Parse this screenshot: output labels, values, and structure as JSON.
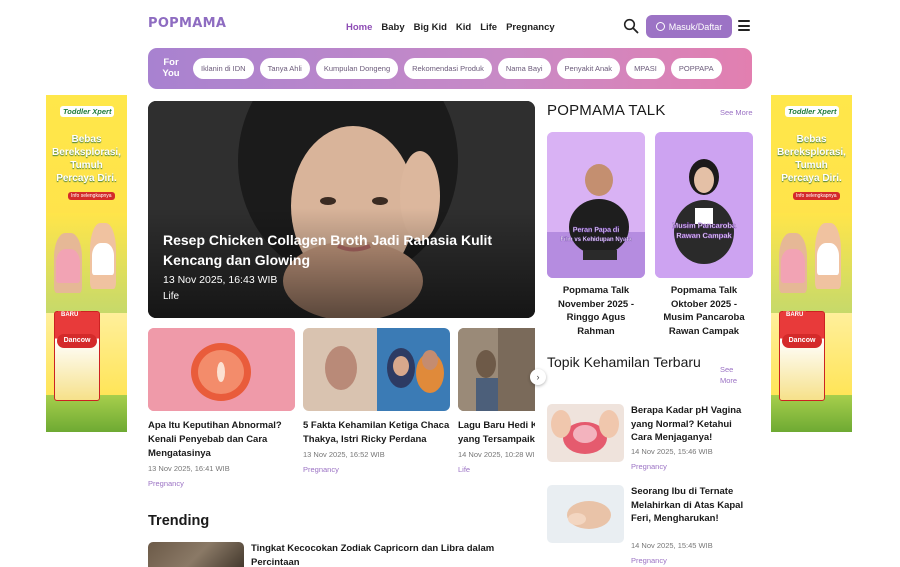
{
  "header": {
    "logo": "POPMAMA",
    "nav": [
      "Home",
      "Baby",
      "Big Kid",
      "Kid",
      "Life",
      "Pregnancy"
    ],
    "active_nav": "Home",
    "login_label": "Masuk/Daftar"
  },
  "for_you": {
    "label_line1": "For",
    "label_line2": "You",
    "chips": [
      "Iklanin di IDN",
      "Tanya Ahli",
      "Kumpulan Dongeng",
      "Rekomendasi Produk",
      "Nama Bayi",
      "Penyakit Anak",
      "MPASI",
      "POPPAPA"
    ]
  },
  "ads": {
    "brand": "Toddler Xpert",
    "headline_l1": "Bebas",
    "headline_l2": "Bereksplorasi,",
    "headline_l3": "Tumuh",
    "headline_l4": "Percaya Diri.",
    "cta": "Info selengkapnya",
    "badge": "BARU",
    "product": "Dancow"
  },
  "hero": {
    "title": "Resep Chicken Collagen Broth Jadi Rahasia Kulit Kencang dan Glowing",
    "date": "13 Nov 2025, 16:43 WIB",
    "category": "Life"
  },
  "cards": [
    {
      "title": "Apa Itu Keputihan Abnormal? Kenali Penyebab dan Cara Mengatasinya",
      "date": "13 Nov 2025, 16:41 WIB",
      "category": "Pregnancy"
    },
    {
      "title": "5 Fakta Kehamilan Ketiga Chaca Thakya, Istri Ricky Perdana",
      "date": "13 Nov 2025, 16:52 WIB",
      "category": "Pregnancy"
    },
    {
      "title": "Lagu Baru Hedi Kisah Cinta yang Tersampaikan",
      "date": "14 Nov 2025, 10:28 WIB",
      "category": "Life"
    }
  ],
  "trending": {
    "heading": "Trending",
    "first_title": "Tingkat Kecocokan Zodiak Capricorn dan Libra dalam Percintaan"
  },
  "talk": {
    "heading": "POPMAMA TALK",
    "see_more": "See More",
    "items": [
      {
        "caption": "Popmama Talk November 2025 - Ringgo Agus Rahman",
        "poster_line1": "Peran Papa di",
        "poster_line2": "Film vs Kehidupan Nyata"
      },
      {
        "caption": "Popmama Talk Oktober 2025 - Musim Pancaroba Rawan Campak",
        "poster_line1": "Musim Pancaroba",
        "poster_line2": "Rawan Campak"
      }
    ]
  },
  "topik": {
    "heading": "Topik Kehamilan Terbaru",
    "see_more_l1": "See",
    "see_more_l2": "More",
    "items": [
      {
        "title": "Berapa Kadar pH Vagina yang Normal? Ketahui Cara Menjaganya!",
        "date": "14 Nov 2025, 15:46 WIB",
        "category": "Pregnancy"
      },
      {
        "title": "Seorang Ibu di Ternate Melahirkan di Atas Kapal Feri, Mengharukan!",
        "date": "14 Nov 2025, 15:45 WIB",
        "category": "Pregnancy"
      }
    ]
  },
  "colors": {
    "accent": "#9c73c5",
    "brand_purple": "#8e6cc1",
    "pink": "#e27fb0"
  }
}
